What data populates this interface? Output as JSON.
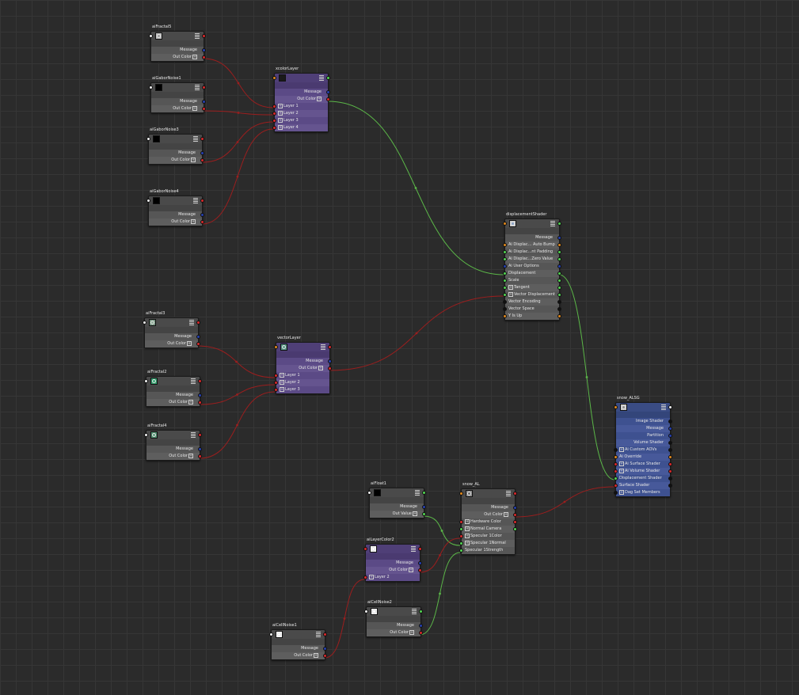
{
  "colors": {
    "background": "#2b2b2b",
    "grid": "#363636",
    "node_gray": "#4a4a4a",
    "node_purple": "#4f3f77",
    "node_blue": "#3a4c84",
    "port_red": "#d8282a",
    "port_blue": "#2540b0",
    "port_green": "#52d452",
    "port_orange": "#e0881c",
    "port_white": "#f2f2f2",
    "port_black": "#111111",
    "wire_red": "#9b1e1e",
    "wire_green": "#5bb748"
  },
  "nodes": {
    "aiFractal5": {
      "title": "aiFractal5",
      "swatch_icon": "sphere-icon",
      "swatch_color": "#bdbdbd",
      "ports": [
        {
          "label": "Message"
        },
        {
          "label": "Out Color"
        }
      ]
    },
    "aiGaborNoise1": {
      "title": "aiGaborNoise1",
      "swatch_icon": "none",
      "swatch_color": "#000000",
      "ports": [
        {
          "label": "Message"
        },
        {
          "label": "Out Color"
        }
      ]
    },
    "aiGaborNoise3": {
      "title": "aiGaborNoise3",
      "swatch_icon": "none",
      "swatch_color": "#000000",
      "ports": [
        {
          "label": "Message"
        },
        {
          "label": "Out Color"
        }
      ]
    },
    "aiGaborNoise4": {
      "title": "aiGaborNoise4",
      "swatch_icon": "none",
      "swatch_color": "#000000",
      "ports": [
        {
          "label": "Message"
        },
        {
          "label": "Out Color"
        }
      ]
    },
    "xcolorLayer": {
      "title": "xcolorLayer",
      "swatch_icon": "none",
      "swatch_color": "#1a1a1a",
      "ports": [
        {
          "label": "Message"
        },
        {
          "label": "Out Color"
        },
        {
          "label": "Layer 1"
        },
        {
          "label": "Layer 2"
        },
        {
          "label": "Layer 3"
        },
        {
          "label": "Layer 4"
        }
      ]
    },
    "displacementShader": {
      "title": "displacementShader",
      "swatch_icon": "displacement-icon",
      "swatch_color": "#c8c8c8",
      "ports": [
        {
          "label": "Message"
        },
        {
          "label": "Ai Displac... Auto Bump"
        },
        {
          "label": "Ai Displac...nt Padding"
        },
        {
          "label": "Ai Displac...Zero Value"
        },
        {
          "label": "Ai User Options"
        },
        {
          "label": "Displacement"
        },
        {
          "label": "Scale"
        },
        {
          "label": "Tangent"
        },
        {
          "label": "Vector Displacement"
        },
        {
          "label": "Vector Encoding"
        },
        {
          "label": "Vector Space"
        },
        {
          "label": "Y Is Up"
        }
      ]
    },
    "aiFractal3": {
      "title": "aiFractal3",
      "swatch_icon": "sphere-icon",
      "swatch_color": "#6f8f7a",
      "ports": [
        {
          "label": "Message"
        },
        {
          "label": "Out Color"
        }
      ]
    },
    "aiFractal2": {
      "title": "aiFractal2",
      "swatch_icon": "sphere-icon",
      "swatch_color": "#2f9a6a",
      "ports": [
        {
          "label": "Message"
        },
        {
          "label": "Out Color"
        }
      ]
    },
    "aiFractal4": {
      "title": "aiFractal4",
      "swatch_icon": "sphere-icon",
      "swatch_color": "#4f8f6f",
      "ports": [
        {
          "label": "Message"
        },
        {
          "label": "Out Color"
        }
      ]
    },
    "vectorLayer": {
      "title": "vectorLayer",
      "swatch_icon": "sphere-icon",
      "swatch_color": "#4f8f7f",
      "ports": [
        {
          "label": "Message"
        },
        {
          "label": "Out Color"
        },
        {
          "label": "Layer 1"
        },
        {
          "label": "Layer 2"
        },
        {
          "label": "Layer 3"
        }
      ]
    },
    "snow_ALSG": {
      "title": "snow_ALSG",
      "swatch_icon": "shading-group-icon",
      "swatch_color": "#c8c8c8",
      "ports": [
        {
          "label": "Image Shader"
        },
        {
          "label": "Message"
        },
        {
          "label": "Partition"
        },
        {
          "label": "Volume Shader"
        },
        {
          "label": "Ai Custom AOVs"
        },
        {
          "label": "Ai Override"
        },
        {
          "label": "Ai Surface Shader"
        },
        {
          "label": "Ai Volume Shader"
        },
        {
          "label": "Displacement Shader"
        },
        {
          "label": "Surface Shader"
        },
        {
          "label": "Dag Set Members"
        }
      ]
    },
    "aiFloat1": {
      "title": "aiFloat1",
      "swatch_icon": "none",
      "swatch_color": "#000000",
      "ports": [
        {
          "label": "Message"
        },
        {
          "label": "Out Value"
        }
      ]
    },
    "snow_AL": {
      "title": "snow_AL",
      "swatch_icon": "sphere-icon",
      "swatch_color": "#8a8a8a",
      "ports": [
        {
          "label": "Message"
        },
        {
          "label": "Out Color"
        },
        {
          "label": "Hardware Color"
        },
        {
          "label": "Normal Camera"
        },
        {
          "label": "Specular 1Color"
        },
        {
          "label": "Specular 1Normal"
        },
        {
          "label": "Specular 1Strength"
        }
      ]
    },
    "aiLayerColor2": {
      "title": "aiLayerColor2",
      "swatch_icon": "sphere-icon",
      "swatch_color": "#ffffff",
      "ports": [
        {
          "label": "Message"
        },
        {
          "label": "Out Color"
        },
        {
          "label": "Layer 2"
        }
      ]
    },
    "aiCellNoise2": {
      "title": "aiCellNoise2",
      "swatch_icon": "sphere-icon",
      "swatch_color": "#f0f0f0",
      "ports": [
        {
          "label": "Message"
        },
        {
          "label": "Out Color"
        }
      ]
    },
    "aiCellNoise1": {
      "title": "aiCellNoise1",
      "swatch_icon": "sphere-icon",
      "swatch_color": "#ffffff",
      "ports": [
        {
          "label": "Message"
        },
        {
          "label": "Out Color"
        }
      ]
    }
  }
}
